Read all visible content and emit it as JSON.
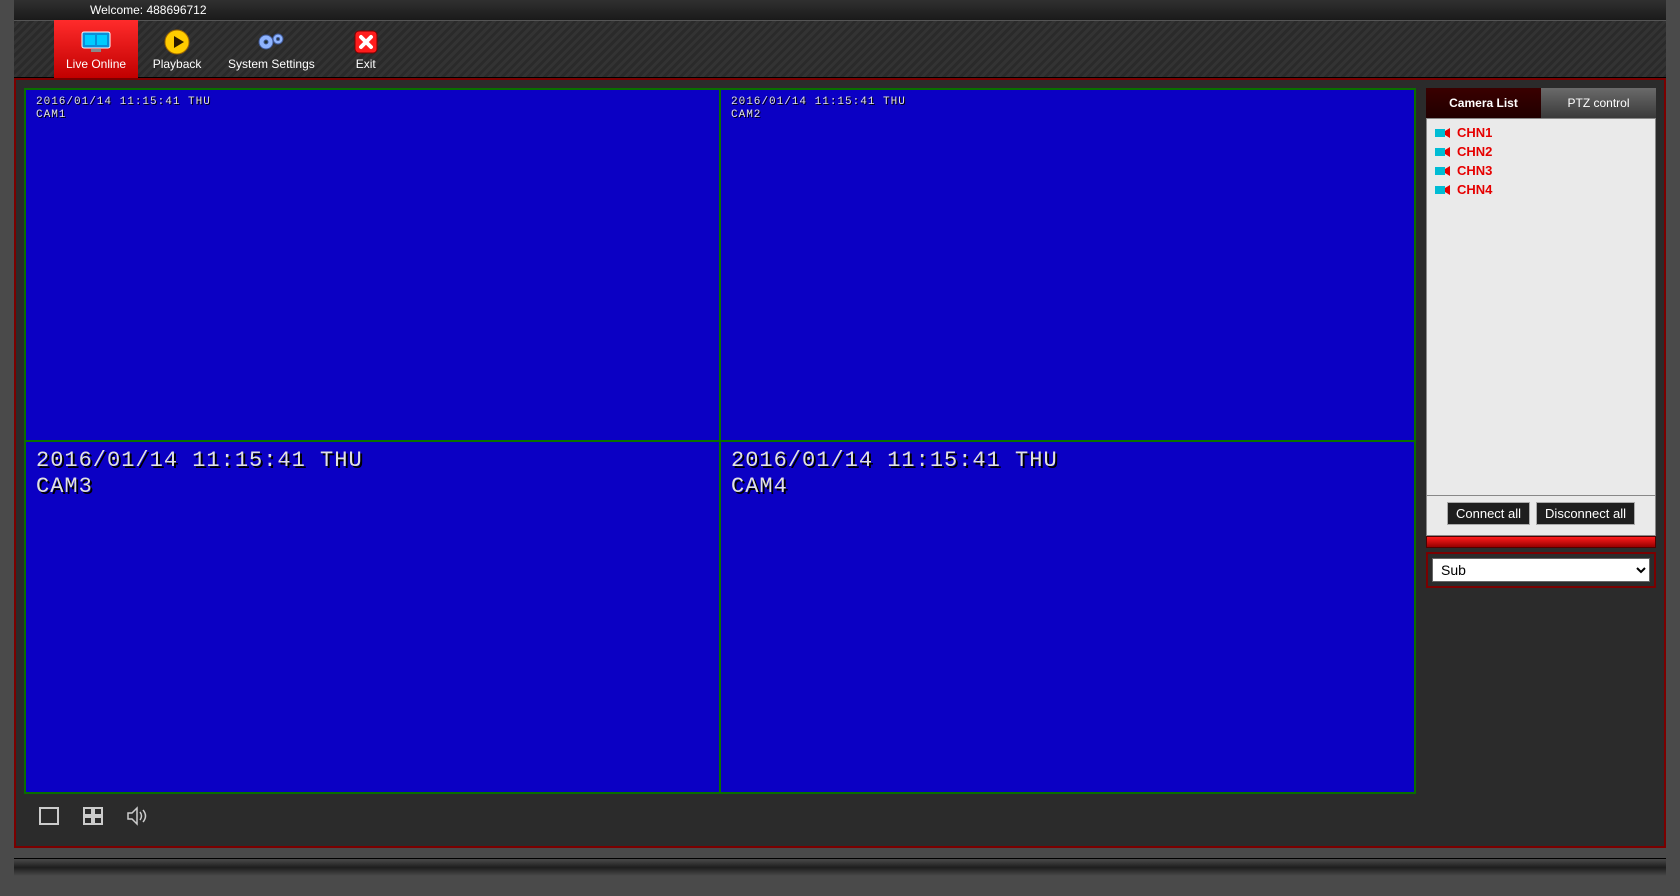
{
  "welcome": "Welcome: 488696712",
  "topbar": {
    "live_online": "Live Online",
    "playback": "Playback",
    "system_settings": "System Settings",
    "exit": "Exit"
  },
  "cams": {
    "cam1": {
      "osd": "2016/01/14 11:15:41 THU\nCAM1"
    },
    "cam2": {
      "osd": "2016/01/14 11:15:41 THU\nCAM2"
    },
    "cam3": {
      "osd": "2016/01/14 11:15:41 THU\nCAM3"
    },
    "cam4": {
      "osd": "2016/01/14 11:15:41 THU\nCAM4"
    }
  },
  "sidebar": {
    "tabs": {
      "camera_list": "Camera List",
      "ptz_control": "PTZ control"
    },
    "channels": [
      "CHN1",
      "CHN2",
      "CHN3",
      "CHN4"
    ],
    "connect_all": "Connect all",
    "disconnect_all": "Disconnect all",
    "stream_select": "Sub"
  }
}
